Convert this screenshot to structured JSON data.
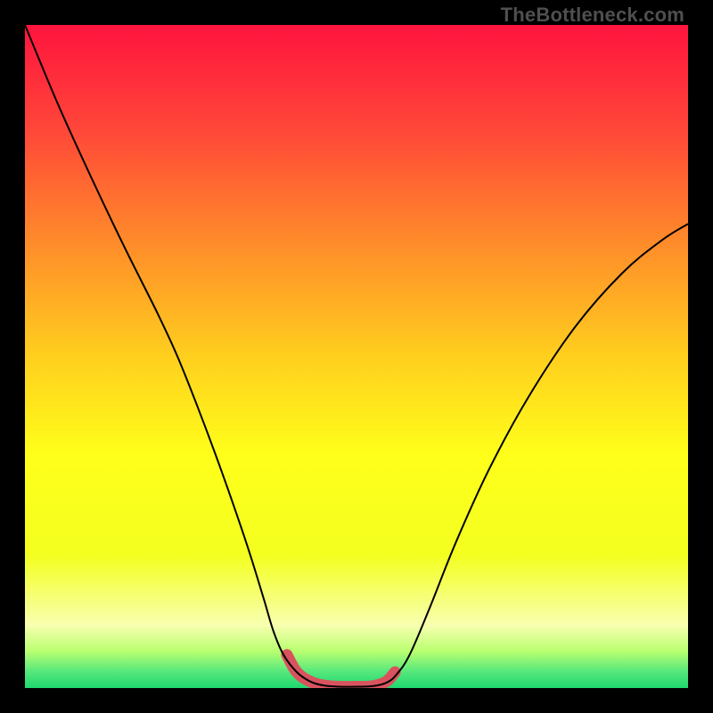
{
  "watermark": "TheBottleneck.com",
  "chart_data": {
    "type": "line",
    "title": "",
    "xlabel": "",
    "ylabel": "",
    "xlim": [
      0,
      1
    ],
    "ylim": [
      0,
      1
    ],
    "grid": false,
    "legend": false,
    "background_gradient": {
      "stops": [
        {
          "offset": 0.0,
          "color": "#ff143e"
        },
        {
          "offset": 0.15,
          "color": "#ff4439"
        },
        {
          "offset": 0.33,
          "color": "#ff8c2a"
        },
        {
          "offset": 0.5,
          "color": "#ffcf1e"
        },
        {
          "offset": 0.65,
          "color": "#ffff1a"
        },
        {
          "offset": 0.8,
          "color": "#f3ff20"
        },
        {
          "offset": 0.905,
          "color": "#f8ffb0"
        },
        {
          "offset": 0.945,
          "color": "#b8ff70"
        },
        {
          "offset": 0.975,
          "color": "#56e87c"
        },
        {
          "offset": 1.0,
          "color": "#1ed86f"
        }
      ]
    },
    "series": [
      {
        "name": "primary-curve",
        "stroke": "#000000",
        "stroke_width": 2,
        "x": [
          0.0,
          0.05,
          0.1,
          0.15,
          0.2,
          0.23,
          0.26,
          0.29,
          0.32,
          0.34,
          0.36,
          0.375,
          0.39,
          0.41,
          0.43,
          0.45,
          0.475,
          0.5,
          0.525,
          0.545,
          0.56,
          0.58,
          0.61,
          0.65,
          0.7,
          0.76,
          0.83,
          0.9,
          0.96,
          1.0
        ],
        "y": [
          1.0,
          0.88,
          0.77,
          0.665,
          0.565,
          0.5,
          0.425,
          0.345,
          0.26,
          0.2,
          0.135,
          0.085,
          0.05,
          0.024,
          0.01,
          0.004,
          0.002,
          0.002,
          0.003,
          0.008,
          0.02,
          0.05,
          0.12,
          0.22,
          0.33,
          0.44,
          0.545,
          0.625,
          0.675,
          0.7
        ]
      },
      {
        "name": "highlight-arc",
        "stroke": "#d9535e",
        "stroke_width": 13,
        "linecap": "round",
        "x": [
          0.395,
          0.41,
          0.43,
          0.45,
          0.475,
          0.5,
          0.525,
          0.545,
          0.558
        ],
        "y": [
          0.05,
          0.024,
          0.01,
          0.004,
          0.002,
          0.002,
          0.003,
          0.01,
          0.024
        ]
      }
    ]
  }
}
